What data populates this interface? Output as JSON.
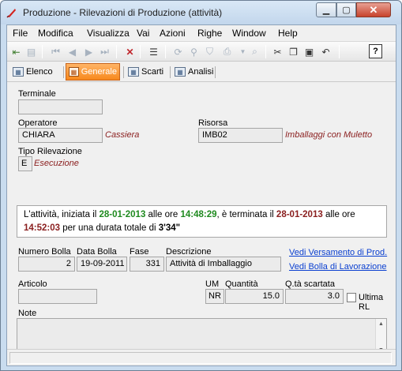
{
  "window": {
    "title": "Produzione - Rilevazioni di Produzione (attività)",
    "close_glyph": "✕",
    "min_glyph": "▁",
    "max_glyph": "▢"
  },
  "menu": [
    "File",
    "Modifica",
    "Visualizza",
    "Vai",
    "Azioni",
    "Righe",
    "Window",
    "Help"
  ],
  "toolbar": {
    "help_label": "?"
  },
  "tabs": [
    {
      "label": "Elenco",
      "active": false
    },
    {
      "label": "Generale",
      "active": true
    },
    {
      "label": "Scarti",
      "active": false
    },
    {
      "label": "Analisi",
      "active": false
    }
  ],
  "form": {
    "terminale": {
      "label": "Terminale",
      "value": ""
    },
    "operatore": {
      "label": "Operatore",
      "value": "CHIARA",
      "desc": "Cassiera"
    },
    "risorsa": {
      "label": "Risorsa",
      "value": "IMB02",
      "desc": "Imballaggi con Muletto"
    },
    "tipo_rilevazione": {
      "label": "Tipo Rilevazione",
      "value": "E",
      "desc": "Esecuzione"
    },
    "info": {
      "p1": "L'attività, iniziata il ",
      "start_date": "28-01-2013",
      "p2": " alle ore ",
      "start_time": "14:48:29",
      "p3": ", è terminata il ",
      "end_date": "28-01-2013",
      "p4": " alle ore ",
      "end_time": "14:52:03",
      "p5": " per una durata totale di ",
      "duration": "3'34\""
    },
    "numero_bolla": {
      "label": "Numero Bolla",
      "value": "2"
    },
    "data_bolla": {
      "label": "Data Bolla",
      "value": "19-09-2011"
    },
    "fase": {
      "label": "Fase",
      "value": "331"
    },
    "descrizione": {
      "label": "Descrizione",
      "value": "Attività di Imballaggio"
    },
    "links": {
      "versamento": "Vedi Versamento di Prod.",
      "bolla": "Vedi Bolla di Lavorazione"
    },
    "articolo": {
      "label": "Articolo",
      "value": ""
    },
    "um": {
      "label": "UM",
      "value": "NR"
    },
    "quantita": {
      "label": "Quantità",
      "value": "15.0"
    },
    "qta_scartata": {
      "label": "Q.tà scartata",
      "value": "3.0"
    },
    "ultima_rl": {
      "label": "Ultima RL",
      "checked": false
    },
    "note": {
      "label": "Note",
      "value": ""
    }
  }
}
